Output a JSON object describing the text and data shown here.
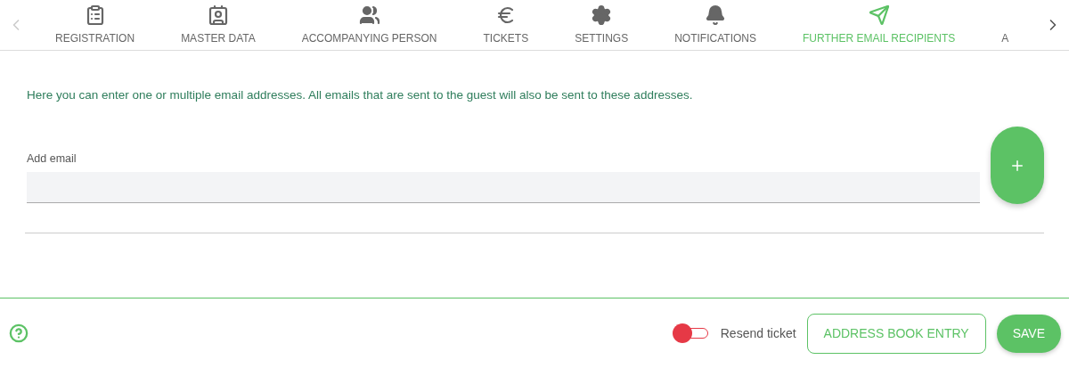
{
  "tabs": [
    {
      "label": "REGISTRATION",
      "selected": false
    },
    {
      "label": "MASTER DATA",
      "selected": false
    },
    {
      "label": "ACCOMPANYING PERSON",
      "selected": false
    },
    {
      "label": "TICKETS",
      "selected": false
    },
    {
      "label": "SETTINGS",
      "selected": false
    },
    {
      "label": "NOTIFICATIONS",
      "selected": false
    },
    {
      "label": "FURTHER EMAIL RECIPIENTS",
      "selected": true
    },
    {
      "label": "A",
      "selected": false
    }
  ],
  "description": "Here you can enter one or multiple email addresses. All emails that are sent to the guest will also be sent to these addresses.",
  "email_field": {
    "label": "Add email"
  },
  "footer": {
    "resend_toggle": {
      "label": "Resend ticket",
      "on": false
    },
    "address_book_button": "ADDRESS BOOK ENTRY",
    "save_button": "SAVE"
  }
}
